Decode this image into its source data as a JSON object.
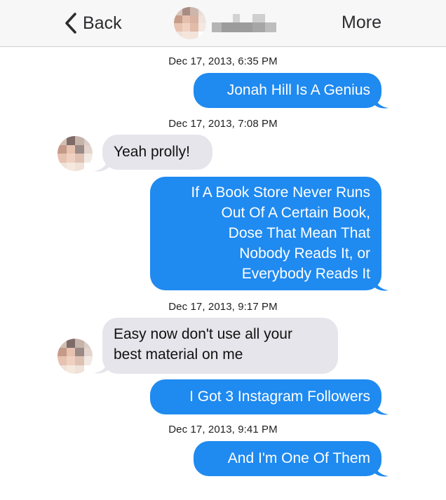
{
  "header": {
    "back_label": "Back",
    "more_label": "More",
    "contact_name": "",
    "back_icon": "chevron-left-icon"
  },
  "colors": {
    "outgoing_bubble": "#1f8af0",
    "incoming_bubble": "#e6e5eb",
    "header_bg": "#f7f7f8"
  },
  "messages": [
    {
      "timestamp": "Dec 17, 2013, 6:35 PM"
    },
    {
      "direction": "out",
      "lines": [
        "Jonah Hill Is A Genius"
      ]
    },
    {
      "timestamp": "Dec 17, 2013, 7:08 PM"
    },
    {
      "direction": "in",
      "lines": [
        "Yeah prolly!"
      ]
    },
    {
      "direction": "out",
      "lines": [
        "If A Book Store Never Runs",
        "Out Of A Certain Book,",
        "Dose That Mean That",
        "Nobody Reads It, or",
        "Everybody Reads It"
      ]
    },
    {
      "timestamp": "Dec 17, 2013, 9:17 PM"
    },
    {
      "direction": "in",
      "lines": [
        "Easy now don't use all your",
        "best material on me"
      ]
    },
    {
      "direction": "out",
      "lines": [
        "I Got 3 Instagram Followers"
      ]
    },
    {
      "timestamp": "Dec 17, 2013, 9:41 PM"
    },
    {
      "direction": "out",
      "lines": [
        "And I'm One Of Them"
      ]
    }
  ]
}
